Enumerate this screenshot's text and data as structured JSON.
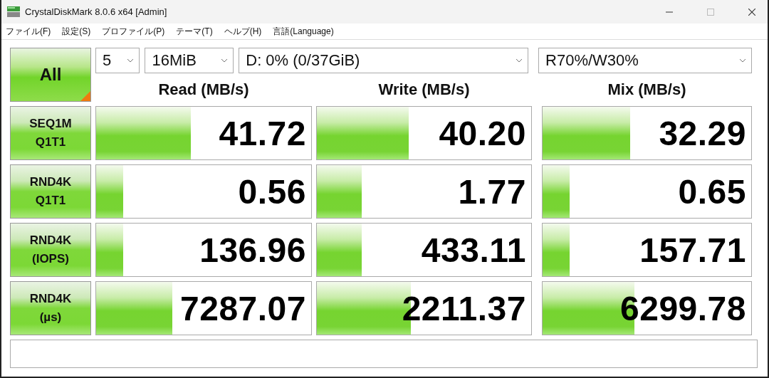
{
  "window": {
    "title": "CrystalDiskMark 8.0.6 x64 [Admin]"
  },
  "menu": [
    "ファイル(F)",
    "設定(S)",
    "プロファイル(P)",
    "テーマ(T)",
    "ヘルプ(H)",
    "言語(Language)"
  ],
  "all_button": {
    "label": "All"
  },
  "settings": {
    "count": "5",
    "size": "16MiB",
    "drive": "D: 0% (0/37GiB)",
    "mix_ratio": "R70%/W30%"
  },
  "columns": [
    "Read (MB/s)",
    "Write (MB/s)",
    "Mix (MB/s)"
  ],
  "rows": [
    {
      "label": [
        "SEQ1M",
        "Q1T1"
      ],
      "results": [
        {
          "value": "41.72",
          "level": 0.44
        },
        {
          "value": "40.20",
          "level": 0.43
        },
        {
          "value": "32.29",
          "level": 0.42
        }
      ]
    },
    {
      "label": [
        "RND4K",
        "Q1T1"
      ],
      "results": [
        {
          "value": "0.56",
          "level": 0.125
        },
        {
          "value": "1.77",
          "level": 0.21
        },
        {
          "value": "0.65",
          "level": 0.13
        }
      ]
    },
    {
      "label": [
        "RND4K",
        "(IOPS)"
      ],
      "results": [
        {
          "value": "136.96",
          "level": 0.125
        },
        {
          "value": "433.11",
          "level": 0.21
        },
        {
          "value": "157.71",
          "level": 0.13
        }
      ]
    },
    {
      "label": [
        "RND4K",
        "(µs)"
      ],
      "results": [
        {
          "value": "7287.07",
          "level": 0.355
        },
        {
          "value": "2211.37",
          "level": 0.44
        },
        {
          "value": "6299.78",
          "level": 0.44
        }
      ]
    }
  ]
}
